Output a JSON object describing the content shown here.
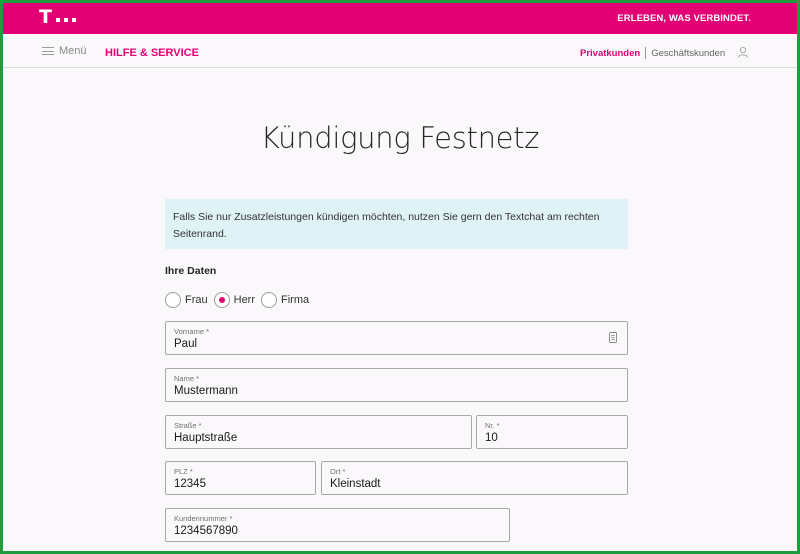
{
  "header": {
    "logo_letter": "T",
    "slogan": "ERLEBEN, WAS VERBINDET.",
    "brand_color": "#e20074"
  },
  "nav": {
    "menu_label": "Menü",
    "service_label": "HILFE & SERVICE",
    "private_label": "Privatkunden",
    "business_label": "Geschäftskunden",
    "user_icon": "user-icon",
    "menu_icon": "hamburger-icon"
  },
  "page": {
    "title": "Kündigung Festnetz",
    "info_text": "Falls Sie nur Zusatzleistungen kündigen möchten, nutzen Sie gern den Textchat am rechten Seitenrand.",
    "info_bg": "#dff2f6"
  },
  "form": {
    "section_title": "Ihre Daten",
    "salutation": {
      "options": [
        "Frau",
        "Herr",
        "Firma"
      ],
      "selected": "Herr"
    },
    "vorname": {
      "label": "Vorname *",
      "value": "Paul"
    },
    "name": {
      "label": "Name *",
      "value": "Mustermann"
    },
    "strasse": {
      "label": "Straße *",
      "value": "Hauptstraße"
    },
    "nr": {
      "label": "Nr. *",
      "value": "10"
    },
    "plz": {
      "label": "PLZ *",
      "value": "12345"
    },
    "ort": {
      "label": "Ort *",
      "value": "Kleinstadt"
    },
    "kundennummer": {
      "label": "Kundennummer *",
      "value": "1234567890"
    }
  }
}
